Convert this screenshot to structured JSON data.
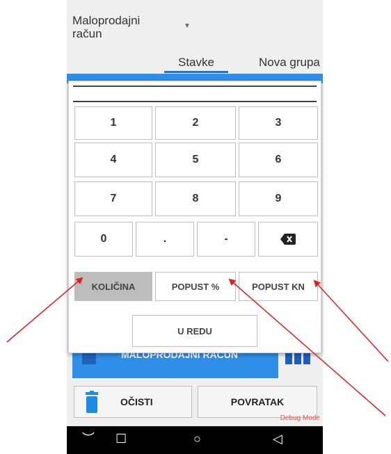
{
  "header": {
    "document_type": "Maloprodajni račun",
    "tabs": [
      {
        "label": "Stavke",
        "active": true
      },
      {
        "label": "Nova grupa",
        "active": false
      }
    ]
  },
  "keypad": {
    "rows": [
      [
        "1",
        "2",
        "3"
      ],
      [
        "4",
        "5",
        "6"
      ],
      [
        "7",
        "8",
        "9"
      ]
    ],
    "bottom_row": [
      "0",
      ".",
      "-"
    ],
    "backspace_icon": "backspace-icon"
  },
  "modes": {
    "kolicina": "KOLIČINA",
    "popust_pct": "POPUST %",
    "popust_kn": "POPUST KN",
    "active": "KOLIČINA"
  },
  "dialog": {
    "ok_label": "U REDU"
  },
  "main": {
    "big_button_label": "MALOPRODAJNI RAČUN",
    "clear_label": "OČISTI",
    "back_label": "POVRATAK",
    "debug_label": "Debug Mode"
  },
  "colors": {
    "accent": "#2f8fe8",
    "annotation_arrow": "#e02020"
  }
}
